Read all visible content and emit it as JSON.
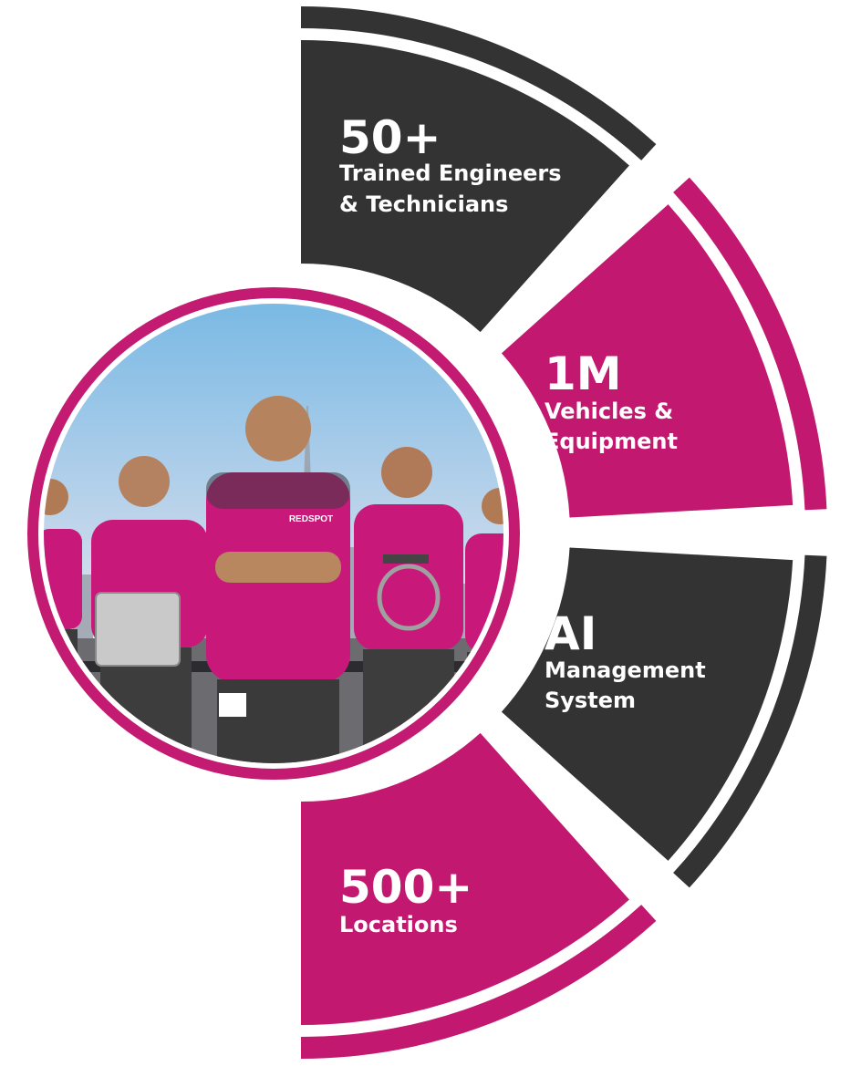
{
  "colors": {
    "dark": "#333333",
    "magenta": "#c2186f",
    "ring_magenta": "#c31a72",
    "sky_top": "#79b9e4",
    "sky_bottom": "#e7e5ef",
    "ground": "#6b6b70",
    "shirt": "#c8197a"
  },
  "segments": [
    {
      "value": "50+",
      "label_lines": [
        "Trained Engineers",
        "& Technicians"
      ]
    },
    {
      "value": "1M",
      "label_lines": [
        "Vehicles &",
        "Equipment"
      ]
    },
    {
      "value": "AI",
      "label_lines": [
        "Management",
        "System"
      ]
    },
    {
      "value": "500+",
      "label_lines": [
        "Locations"
      ]
    }
  ],
  "photo": {
    "description_icon": "team-photo",
    "brand_badge": "REDSPOT"
  }
}
